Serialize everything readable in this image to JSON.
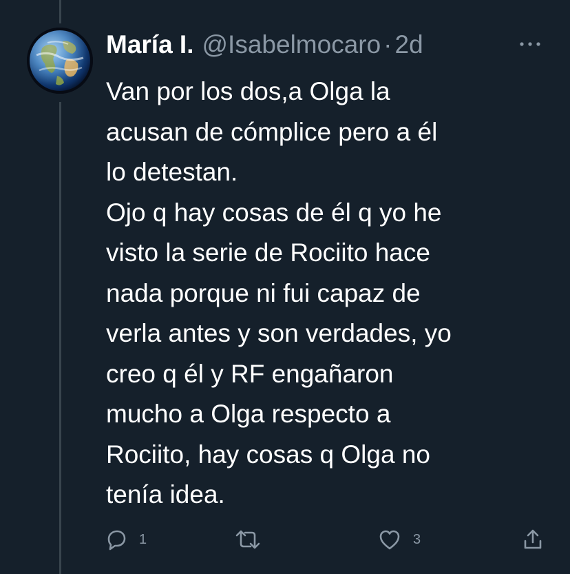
{
  "colors": {
    "background": "#15202b",
    "text": "#ffffff",
    "secondary": "#8b98a5",
    "thread_line": "#38444d"
  },
  "tweet": {
    "display_name": "María I.",
    "handle": "@Isabelmocaro",
    "separator": "·",
    "time": "2d",
    "text": "Van por los dos,a Olga la\nacusan de cómplice pero a él\nlo detestan.\nOjo q hay cosas de él q yo he\nvisto la serie de Rociito hace\nnada porque ni fui capaz de\nverla antes y son verdades, yo\ncreo q él y RF engañaron\nmucho a Olga respecto a\nRociito, hay cosas q Olga no\ntenía idea.",
    "avatar_icon": "earth-globe-avatar",
    "more_icon": "more-icon"
  },
  "actions": {
    "reply": {
      "icon": "reply-icon",
      "count": "1"
    },
    "retweet": {
      "icon": "retweet-icon",
      "count": ""
    },
    "like": {
      "icon": "heart-icon",
      "count": "3"
    },
    "share": {
      "icon": "share-icon",
      "count": ""
    }
  }
}
